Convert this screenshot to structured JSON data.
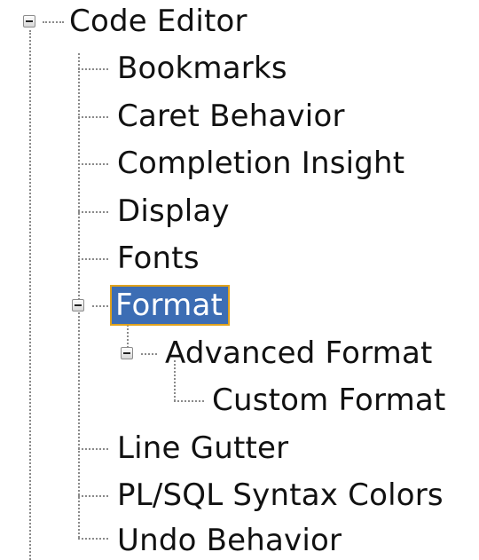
{
  "tree": {
    "root": {
      "label": "Code Editor",
      "expanded": true
    },
    "children": [
      {
        "label": "Bookmarks"
      },
      {
        "label": "Caret Behavior"
      },
      {
        "label": "Completion Insight"
      },
      {
        "label": "Display"
      },
      {
        "label": "Fonts"
      },
      {
        "label": "Format",
        "selected": true,
        "expanded": true,
        "children": [
          {
            "label": "Advanced Format",
            "expanded": true,
            "children": [
              {
                "label": "Custom Format"
              }
            ]
          }
        ]
      },
      {
        "label": "Line Gutter"
      },
      {
        "label": "PL/SQL Syntax Colors"
      },
      {
        "label": "Undo Behavior"
      }
    ]
  },
  "colors": {
    "selection_background": "#3c6db4",
    "selection_border": "#e0a21d",
    "connector": "#8a8a8a"
  }
}
